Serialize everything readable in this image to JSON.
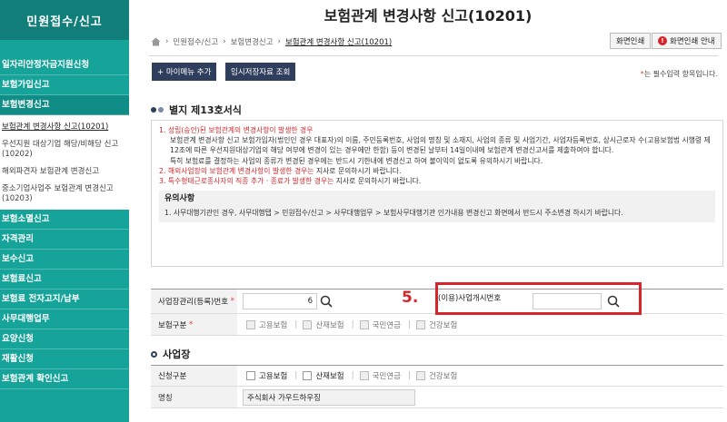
{
  "sidebar": {
    "title": "민원접수/신고",
    "menu_top": [
      "일자리안정자금지원신청",
      "보험가입신고",
      "보험변경신고"
    ],
    "sub_items": [
      "보험관계 변경사항 신고(10201)",
      "우선지원 대상기업 해당/비해당 신고(10202)",
      "해외파견자 보험관계 변경신고",
      "중소기업사업주 보험관계 변경신고(10203)"
    ],
    "menu_bottom": [
      "보험소멸신고",
      "자격관리",
      "보수신고",
      "보험료신고",
      "보험료 전자고지/납부",
      "사무대행업무",
      "요양신청",
      "재활신청",
      "보험관계 확인신고"
    ]
  },
  "header": {
    "title": "보험관계 변경사항 신고(10201)",
    "breadcrumb": [
      "민원접수/신고",
      "보험변경신고",
      "보험관계 변경사항 신고(10201)"
    ],
    "print_label": "화면인쇄",
    "print_guide_label": "화면인쇄 안내"
  },
  "toolbar": {
    "add_menu_label": "+ 마이메뉴 추가",
    "temp_load_label": "임시저장자료 조회",
    "required_star": "*",
    "required_note": "는 필수입력 항목입니다."
  },
  "form_section": {
    "title": "별지 제13호서식",
    "n1_title": "1. 성립(승인)된 보험관계의 변경사항이 발생한 경우",
    "n1_body": "보험관계 변경사항 신고 보험가입자(법인인 경우 대표자)의 이름, 주민등록번호, 사업의 명칭 및 소재지, 사업의 종류 및 사업기간, 사업자등록번호, 상시근로자 수(고용보험법 시행령 제12조에 따른 우선지원대상기업의 해당 여부에 변경이 있는 경우에만 한함) 등이 변경된 날부터 14일이내에 보험관계 변경신고서를 제출하여야 합니다.",
    "n1_note": "특히 보험료를 결정하는 사업의 종류가 변경된 경우에는 반드시 기한내에 변경신고 하여 불이익이 없도록 유의하시기 바랍니다.",
    "n2_red": "2. 해외사업장의 보험관계 변경사항이 발생한 경우는",
    "n2_rest": " 지사로 문의하시기 바랍니다.",
    "n3_red": "3. 특수형태근로종사자의 직종 추가 · 종료가 발생한 경우는",
    "n3_rest": " 지사로 문의하시기 바랍니다.",
    "caution_title": "유의사항",
    "caution_body": "1. 사무대행기관인 경우, 사무대행탭 > 민원접수/신고 > 사무대행업무 > 보험사무대행기관 인가내용 변경신고 화면에서 반드시 주소변경 하시기 바랍니다."
  },
  "form": {
    "reg_label": "사업장관리(등록)번호",
    "reg_value": "6",
    "open_label": "(이용)사업개시번호",
    "open_value": "",
    "step_marker": "5.",
    "ins_label": "보험구분",
    "ins_options": [
      "고용보험",
      "산재보험",
      "국민연금",
      "건강보험"
    ]
  },
  "biz_section": {
    "title": "사업장",
    "type_label": "신청구분",
    "type_options": [
      "고용보험",
      "산재보험",
      "국민연금",
      "건강보험"
    ],
    "name_label": "명칭",
    "name_value": "주식회사 가우드하우징"
  },
  "colors": {
    "accent": "#16a39a",
    "navy": "#2e3e5c",
    "red": "#d7262b"
  }
}
